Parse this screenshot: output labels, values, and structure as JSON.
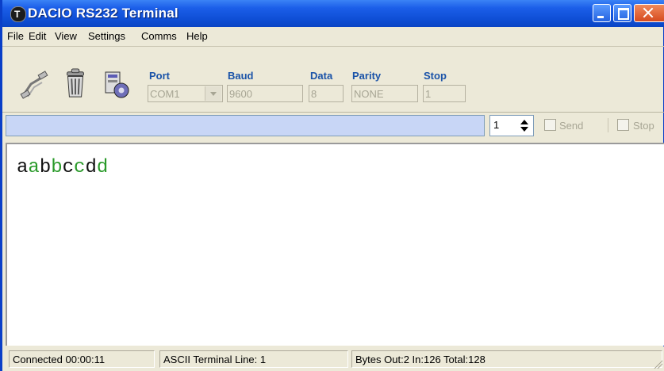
{
  "window": {
    "title": "DACIO RS232 Terminal",
    "icon": "terminal-app-icon"
  },
  "menu": [
    "File",
    "Edit",
    "View",
    "Settings",
    "Comms",
    "Help"
  ],
  "toolbar": {
    "port": {
      "label": "Port",
      "value": "COM1"
    },
    "baud": {
      "label": "Baud",
      "value": "9600"
    },
    "data": {
      "label": "Data",
      "value": "8"
    },
    "parity": {
      "label": "Parity",
      "value": "NONE"
    },
    "stop": {
      "label": "Stop",
      "value": "1"
    }
  },
  "send": {
    "input_value": "",
    "repeat": "1",
    "send_label": "Send",
    "stop_label": "Stop"
  },
  "terminal": {
    "segments": [
      {
        "text": "a",
        "color": "#111111"
      },
      {
        "text": "a",
        "color": "#2a9a2a"
      },
      {
        "text": "b",
        "color": "#111111"
      },
      {
        "text": "b",
        "color": "#2a9a2a"
      },
      {
        "text": "c",
        "color": "#111111"
      },
      {
        "text": "c",
        "color": "#2a9a2a"
      },
      {
        "text": "d",
        "color": "#111111"
      },
      {
        "text": "d",
        "color": "#2a9a2a"
      }
    ]
  },
  "status": {
    "connected": "Connected 00:00:11",
    "mode": "ASCII Terminal Line: 1",
    "bytes": "Bytes Out:2  In:126  Total:128"
  }
}
